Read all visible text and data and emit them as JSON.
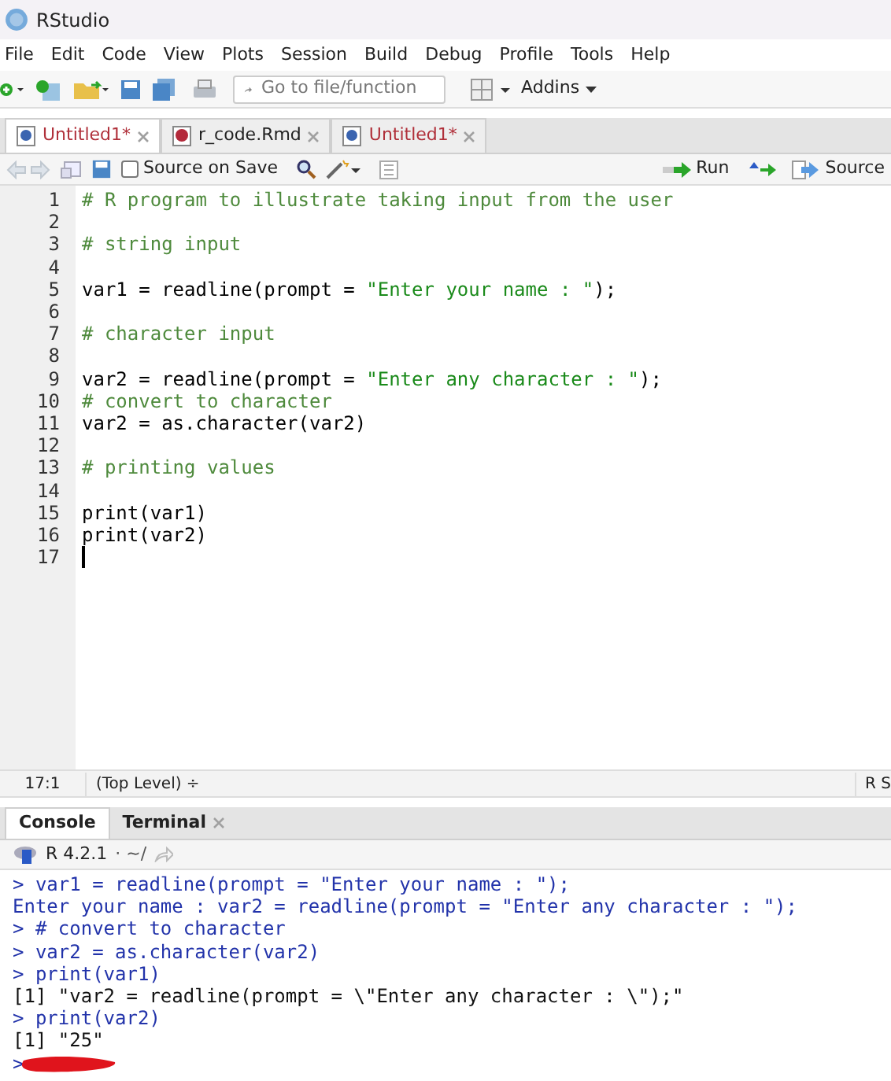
{
  "window": {
    "title": "RStudio"
  },
  "menu": [
    "File",
    "Edit",
    "Code",
    "View",
    "Plots",
    "Session",
    "Build",
    "Debug",
    "Profile",
    "Tools",
    "Help"
  ],
  "toolbar": {
    "goto_placeholder": "Go to file/function",
    "addins": "Addins"
  },
  "editor_tabs": [
    {
      "label": "Untitled1*",
      "kind": "r",
      "modified": true,
      "selected": true
    },
    {
      "label": "r_code.Rmd",
      "kind": "rmd",
      "modified": false,
      "selected": false
    },
    {
      "label": "Untitled1*",
      "kind": "r",
      "modified": true,
      "selected": false
    }
  ],
  "editor_toolbar": {
    "source_on_save": {
      "label": "Source on Save",
      "checked": false
    },
    "run": "Run",
    "source": "Source"
  },
  "editor_lines": [
    {
      "number": "1",
      "segments": [
        {
          "kind": "comment",
          "text": "# R program to illustrate taking input from the user"
        }
      ]
    },
    {
      "number": "2"
    },
    {
      "number": "3",
      "segments": [
        {
          "kind": "comment",
          "text": "# string input"
        }
      ]
    },
    {
      "number": "4"
    },
    {
      "number": "5",
      "segments": [
        {
          "kind": "code",
          "text": "var1 = readline(prompt = "
        },
        {
          "kind": "string",
          "text": "\"Enter your name : \""
        },
        {
          "kind": "code",
          "text": ");"
        }
      ]
    },
    {
      "number": "6"
    },
    {
      "number": "7",
      "segments": [
        {
          "kind": "comment",
          "text": "# character input"
        }
      ]
    },
    {
      "number": "8"
    },
    {
      "number": "9",
      "segments": [
        {
          "kind": "code",
          "text": "var2 = readline(prompt = "
        },
        {
          "kind": "string",
          "text": "\"Enter any character : \""
        },
        {
          "kind": "code",
          "text": ");"
        }
      ]
    },
    {
      "number": "10",
      "segments": [
        {
          "kind": "comment",
          "text": "# convert to character"
        }
      ]
    },
    {
      "number": "11",
      "segments": [
        {
          "kind": "code",
          "text": "var2 = as.character(var2)"
        }
      ]
    },
    {
      "number": "12"
    },
    {
      "number": "13",
      "segments": [
        {
          "kind": "comment",
          "text": "# printing values"
        }
      ]
    },
    {
      "number": "14"
    },
    {
      "number": "15",
      "segments": [
        {
          "kind": "code",
          "text": "print(var1)"
        }
      ]
    },
    {
      "number": "16",
      "segments": [
        {
          "kind": "code",
          "text": "print(var2)"
        }
      ]
    },
    {
      "number": "17"
    }
  ],
  "status_bar": {
    "position": "17:1",
    "scope": "(Top Level) ÷",
    "file_type": "R S"
  },
  "console_tabs": [
    {
      "label": "Console",
      "closable": false,
      "selected": true
    },
    {
      "label": "Terminal",
      "closable": true,
      "selected": false
    }
  ],
  "console_header": {
    "version": "R 4.2.1",
    "path": "· ~/"
  },
  "console_lines": [
    {
      "kind": "input",
      "text": "> var1 = readline(prompt = \"Enter your name : \");"
    },
    {
      "kind": "input",
      "text": "Enter your name : var2 = readline(prompt = \"Enter any character : \");"
    },
    {
      "kind": "input",
      "text": "> # convert to character"
    },
    {
      "kind": "input",
      "text": "> var2 = as.character(var2)"
    },
    {
      "kind": "input",
      "text": "> print(var1)"
    },
    {
      "kind": "output",
      "text": "[1] \"var2 = readline(prompt = \\\"Enter any character : \\\");\""
    },
    {
      "kind": "input",
      "text": "> print(var2)"
    },
    {
      "kind": "output",
      "text": "[1] \"25\""
    },
    {
      "kind": "prompt",
      "text": ">"
    }
  ]
}
